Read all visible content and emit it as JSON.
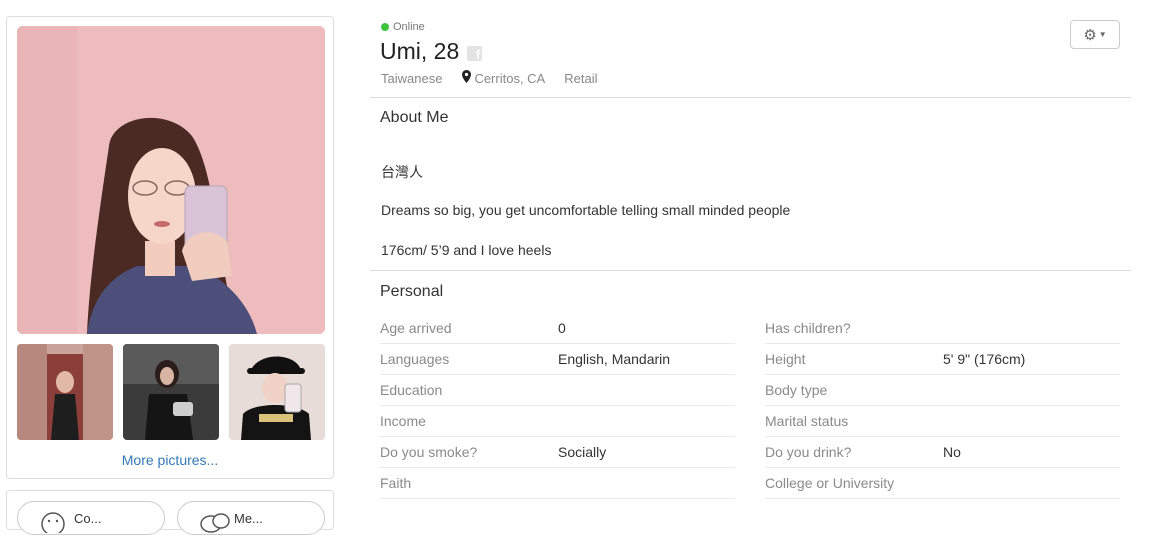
{
  "profile": {
    "status": "Online",
    "name_age": "Umi, 28",
    "fb_glyph": "f",
    "ethnicity": "Taiwanese",
    "location": "Cerritos, CA",
    "occupation": "Retail"
  },
  "photos": {
    "more_label": "More pictures..."
  },
  "actions": {
    "first_label": "Co...",
    "second_label": "Me..."
  },
  "about": {
    "title": "About Me",
    "line1": "台灣人",
    "line2": "Dreams so big, you get uncomfortable telling small minded people",
    "line3": "176cm/ 5’9 and I love heels"
  },
  "personal": {
    "title": "Personal",
    "left": [
      {
        "label": "Age arrived",
        "value": "0"
      },
      {
        "label": "Languages",
        "value": "English, Mandarin"
      },
      {
        "label": "Education",
        "value": ""
      },
      {
        "label": "Income",
        "value": ""
      },
      {
        "label": "Do you smoke?",
        "value": "Socially"
      },
      {
        "label": "Faith",
        "value": ""
      }
    ],
    "right": [
      {
        "label": "Has children?",
        "value": ""
      },
      {
        "label": "Height",
        "value": "5' 9\" (176cm)"
      },
      {
        "label": "Body type",
        "value": ""
      },
      {
        "label": "Marital status",
        "value": ""
      },
      {
        "label": "Do you drink?",
        "value": "No"
      },
      {
        "label": "College or University",
        "value": ""
      }
    ]
  },
  "icons": {
    "settings": "gear-icon",
    "location": "map-pin-icon",
    "facebook": "facebook-icon"
  },
  "colors": {
    "online": "#3ec33e",
    "link": "#337ab7",
    "label": "#8a8a8a"
  }
}
